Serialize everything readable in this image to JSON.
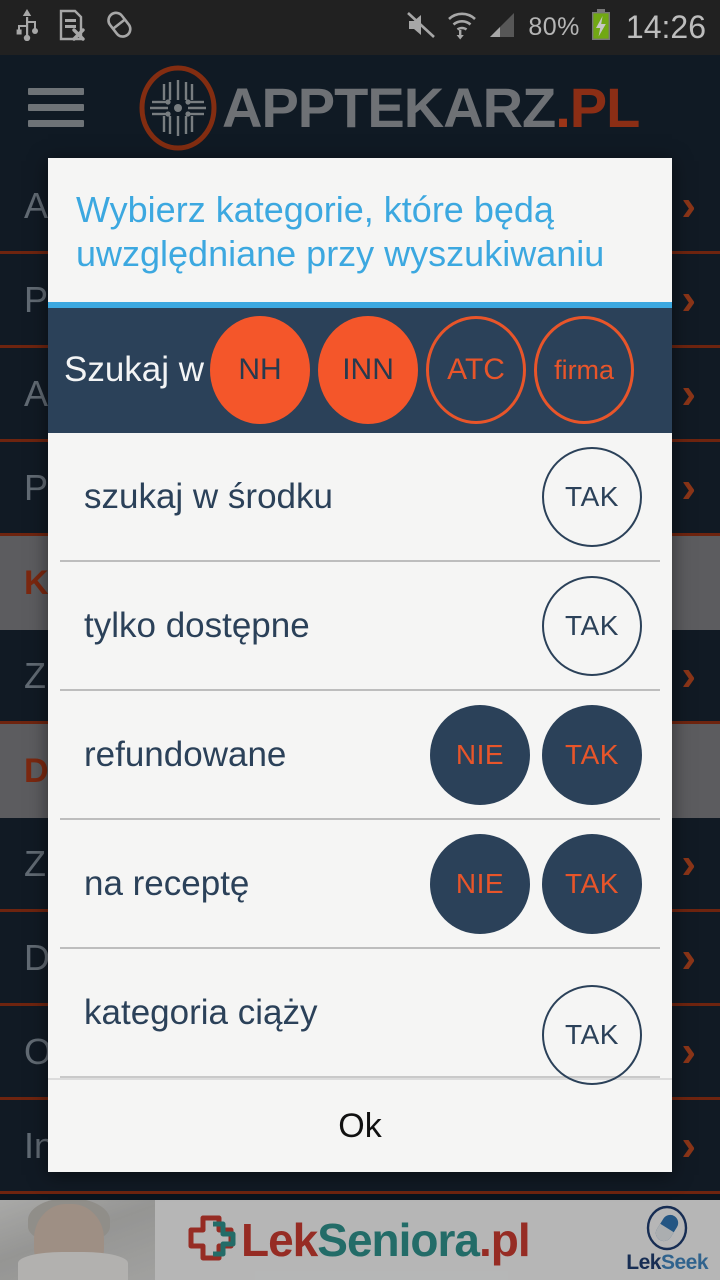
{
  "status_bar": {
    "icons_left": [
      "usb-icon",
      "sim-card-error-icon",
      "pill-icon"
    ],
    "icons_right": [
      "mute-icon",
      "wifi-icon",
      "signal-icon"
    ],
    "battery_percent": "80%",
    "battery_state": "charging",
    "clock": "14:26"
  },
  "app_header": {
    "menu_icon": "hamburger-menu-icon",
    "logo_icon": "apptekarz-circuit-logo-icon",
    "logo_name": "APPTEKARZ",
    "logo_dot": ".",
    "logo_tld": "PL"
  },
  "background_list": {
    "items": [
      {
        "text": "An",
        "type": "item"
      },
      {
        "text": "Po",
        "type": "item"
      },
      {
        "text": "Ak",
        "type": "item"
      },
      {
        "text": "Po",
        "type": "item"
      },
      {
        "text": "KA",
        "type": "header"
      },
      {
        "text": "Zn",
        "type": "item"
      },
      {
        "text": "DO",
        "type": "header"
      },
      {
        "text": "Zn",
        "type": "item"
      },
      {
        "text": "Do",
        "type": "item"
      },
      {
        "text": "Od",
        "type": "item"
      },
      {
        "text": "Inn",
        "type": "item"
      }
    ],
    "chevron": "›"
  },
  "dialog": {
    "title": "Wybierz kategorie, które będą uwzględniane przy wyszukiwaniu",
    "search_in": {
      "label": "Szukaj w",
      "chips": [
        {
          "label": "NH",
          "selected": true
        },
        {
          "label": "INN",
          "selected": true
        },
        {
          "label": "ATC",
          "selected": false
        },
        {
          "label": "firma",
          "selected": false
        }
      ]
    },
    "options": [
      {
        "label": "szukaj w środku",
        "toggles": [
          {
            "label": "TAK",
            "style": "outline"
          }
        ]
      },
      {
        "label": "tylko dostępne",
        "toggles": [
          {
            "label": "TAK",
            "style": "outline"
          }
        ]
      },
      {
        "label": "refundowane",
        "toggles": [
          {
            "label": "NIE",
            "style": "filled"
          },
          {
            "label": "TAK",
            "style": "filled"
          }
        ]
      },
      {
        "label": "na receptę",
        "toggles": [
          {
            "label": "NIE",
            "style": "filled"
          },
          {
            "label": "TAK",
            "style": "filled"
          }
        ]
      },
      {
        "label": "kategoria ciąży",
        "toggles": [
          {
            "label": "TAK",
            "style": "outline"
          }
        ]
      }
    ],
    "ok_label": "Ok"
  },
  "ad_banner": {
    "brand_lek": "Lek",
    "brand_seniora": "Seniora",
    "brand_suffix": ".pl",
    "cross_icon": "medical-cross-icon",
    "partner_lek": "Lek",
    "partner_seek": "Seek",
    "partner_icon": "capsule-icon"
  },
  "colors": {
    "accent_blue": "#3ca8e0",
    "accent_orange": "#f4562a",
    "navy": "#2b4159",
    "dialog_bg": "#f5f5f4",
    "app_bg": "#16222f"
  }
}
